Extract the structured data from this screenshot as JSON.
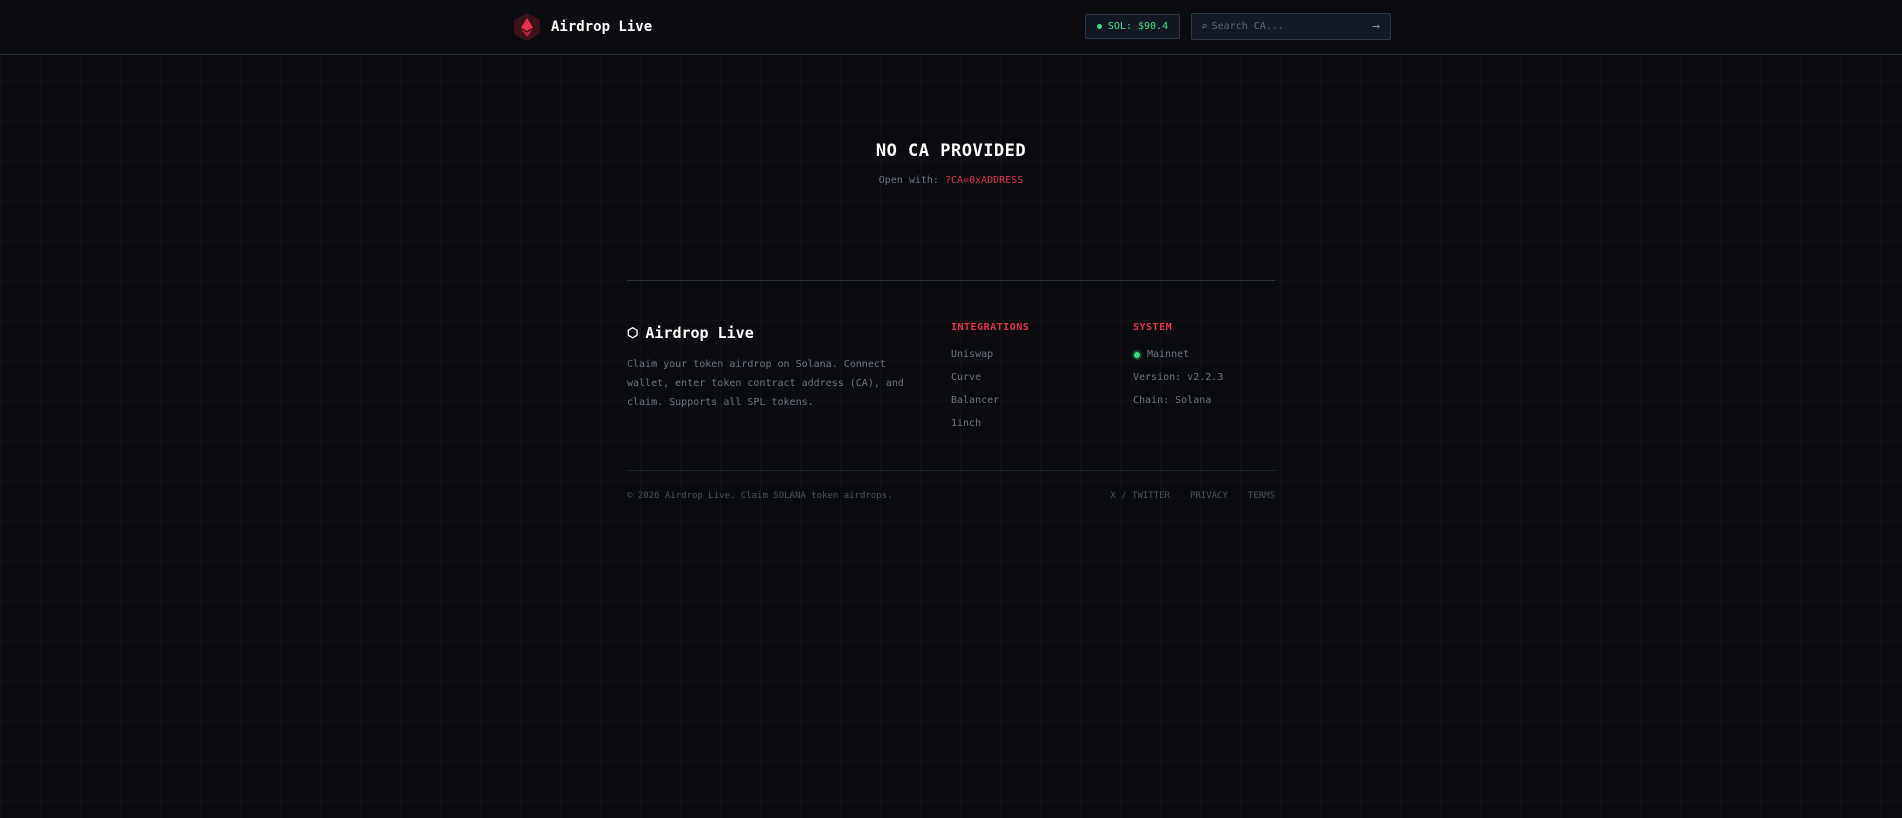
{
  "header": {
    "brand_name": "Airdrop Live",
    "sol_price": "SOL: $90.4",
    "search_placeholder": "Search CA...",
    "search_icon_glyph": "⌕",
    "search_go_glyph": "→"
  },
  "message": {
    "title": "NO CA PROVIDED",
    "hint_prefix": "Open with:",
    "hint_code": "?CA=0xADDRESS"
  },
  "footer": {
    "brand_icon_glyph": "⬡",
    "brand_name": "Airdrop Live",
    "description": "Claim your token airdrop on Solana. Connect wallet, enter token contract address (CA), and claim. Supports all SPL tokens.",
    "integrations": {
      "heading": "INTEGRATIONS",
      "items": [
        "Uniswap",
        "Curve",
        "Balancer",
        "1inch"
      ]
    },
    "system": {
      "heading": "SYSTEM",
      "status": "Mainnet",
      "version": "Version: v2.2.3",
      "chain": "Chain: Solana"
    },
    "copyright": "© 2026 Airdrop Live. Claim SOLANA token airdrops.",
    "links": [
      "X / TWITTER",
      "PRIVACY",
      "TERMS"
    ]
  },
  "colors": {
    "accent": "#e0344d",
    "status_green": "#3ddc84",
    "background": "#0a0c10"
  }
}
